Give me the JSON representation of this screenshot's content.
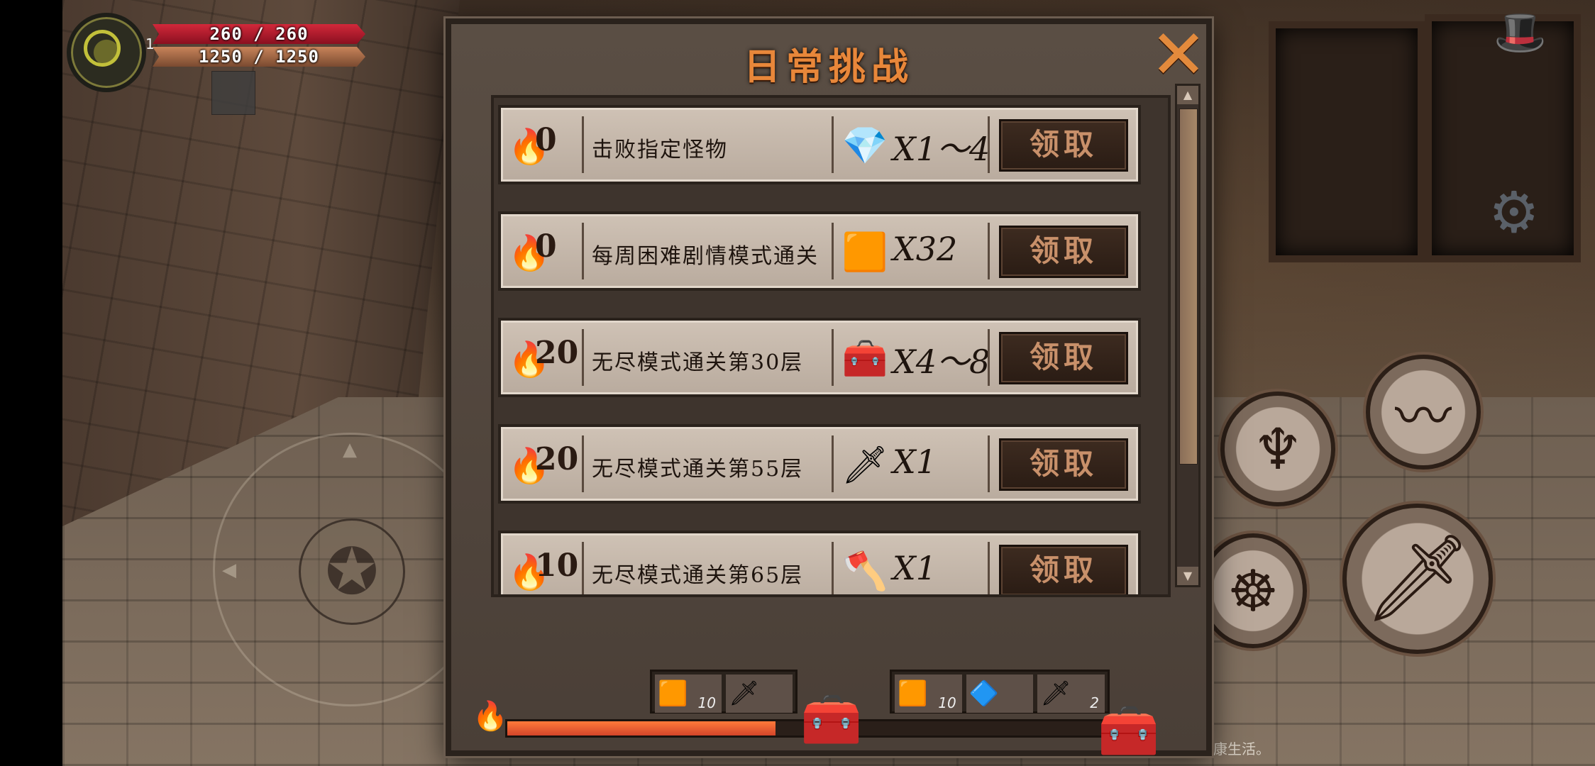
{
  "hud": {
    "level": "1",
    "hp_text": "260 / 260",
    "mp_text": "1250 / 1250",
    "hp_color": "#d2283a",
    "mp_color": "#c8845a"
  },
  "modal": {
    "title": "日常挑战",
    "close_icon": "close-x"
  },
  "challenges": [
    {
      "points": "0",
      "description": "击败指定怪物",
      "reward_icon": "mystery-crystal",
      "reward_qty": "X1～4",
      "claim_label": "领取"
    },
    {
      "points": "0",
      "description": "每周困难剧情模式通关",
      "reward_icon": "glowing-cube",
      "reward_qty": "X32",
      "claim_label": "领取"
    },
    {
      "points": "20",
      "description": "无尽模式通关第30层",
      "reward_icon": "treasure-chest",
      "reward_qty": "X4～8",
      "claim_label": "领取"
    },
    {
      "points": "20",
      "description": "无尽模式通关第55层",
      "reward_icon": "red-blade",
      "reward_qty": "X1",
      "claim_label": "领取"
    },
    {
      "points": "10",
      "description": "无尽模式通关第65层",
      "reward_icon": "red-axe",
      "reward_qty": "X1",
      "claim_label": "领取"
    }
  ],
  "progress": {
    "fraction": 0.43,
    "milestone1_rewards": [
      {
        "icon": "glowing-cube",
        "count": "10"
      },
      {
        "icon": "red-blade",
        "count": ""
      }
    ],
    "milestone2_rewards": [
      {
        "icon": "glowing-cube",
        "count": "10"
      },
      {
        "icon": "blue-eye-gem",
        "count": ""
      },
      {
        "icon": "red-blade",
        "count": "2"
      }
    ]
  },
  "bottom_text": "康生活。"
}
